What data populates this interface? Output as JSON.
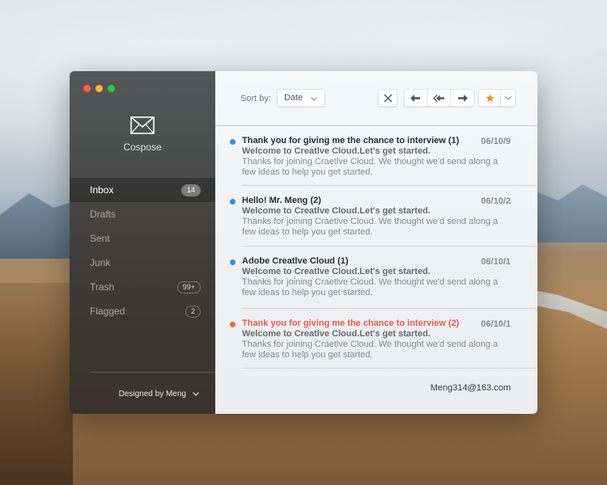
{
  "app": {
    "name": "Cospose",
    "logo_icon": "envelope-icon"
  },
  "window_controls": [
    "close",
    "minimize",
    "zoom"
  ],
  "sidebar": {
    "items": [
      {
        "label": "Inbox",
        "badge": "14",
        "active": true
      },
      {
        "label": "Drafts",
        "badge": null
      },
      {
        "label": "Sent",
        "badge": null
      },
      {
        "label": "Junk",
        "badge": null
      },
      {
        "label": "Trash",
        "badge": "99+"
      },
      {
        "label": "Flagged",
        "badge": "2"
      }
    ],
    "footer": {
      "label": "Designed by Meng",
      "icon": "chevron-down-icon"
    }
  },
  "toolbar": {
    "sort_label": "Sort by:",
    "sort_value": "Date",
    "buttons": [
      "close-icon",
      "reply-icon",
      "reply-all-icon",
      "forward-icon",
      "star-icon",
      "chevron-down-icon"
    ]
  },
  "mails": [
    {
      "subject": "Thank you for giving me the chance to interview (1)",
      "date": "06/10/9",
      "preview_title": "Welcome to Creatlve Cloud.Let's get started.",
      "preview_body": "Thanks for joining Craetlve Cloud. We thought we'd send along a few ideas to help you get started.",
      "dot_color": "#2f8fe0",
      "highlight": false
    },
    {
      "subject": "Hello! Mr. Meng (2)",
      "date": "06/10/2",
      "preview_title": "Welcome to Creatlve Cloud.Let's get started.",
      "preview_body": "Thanks for joining Craetlve Cloud. We thought we'd send along a few ideas to help you get started.",
      "dot_color": "#2f8fe0",
      "highlight": false
    },
    {
      "subject": "Adobe Creatlve Cloud (1)",
      "date": "06/10/1",
      "preview_title": "Welcome to Creatlve Cloud.Let's get started.",
      "preview_body": "Thanks for joining Craetlve Cloud. We thought we'd send along a few ideas to help you get started.",
      "dot_color": "#2f8fe0",
      "highlight": false
    },
    {
      "subject": "Thank you for giving me the chance to interview (2)",
      "date": "06/10/1",
      "preview_title": "Welcome to Creatlve Cloud.Let's get started.",
      "preview_body": "Thanks for joining Craetlve Cloud. We thought we'd send along a few ideas to help you get started.",
      "dot_color": "#ec6a4c",
      "highlight": true
    }
  ],
  "account": "Meng314@163.com",
  "colors": {
    "accent_blue": "#2f8fe0",
    "accent_red": "#ec5a4c",
    "star": "#f08a24"
  }
}
